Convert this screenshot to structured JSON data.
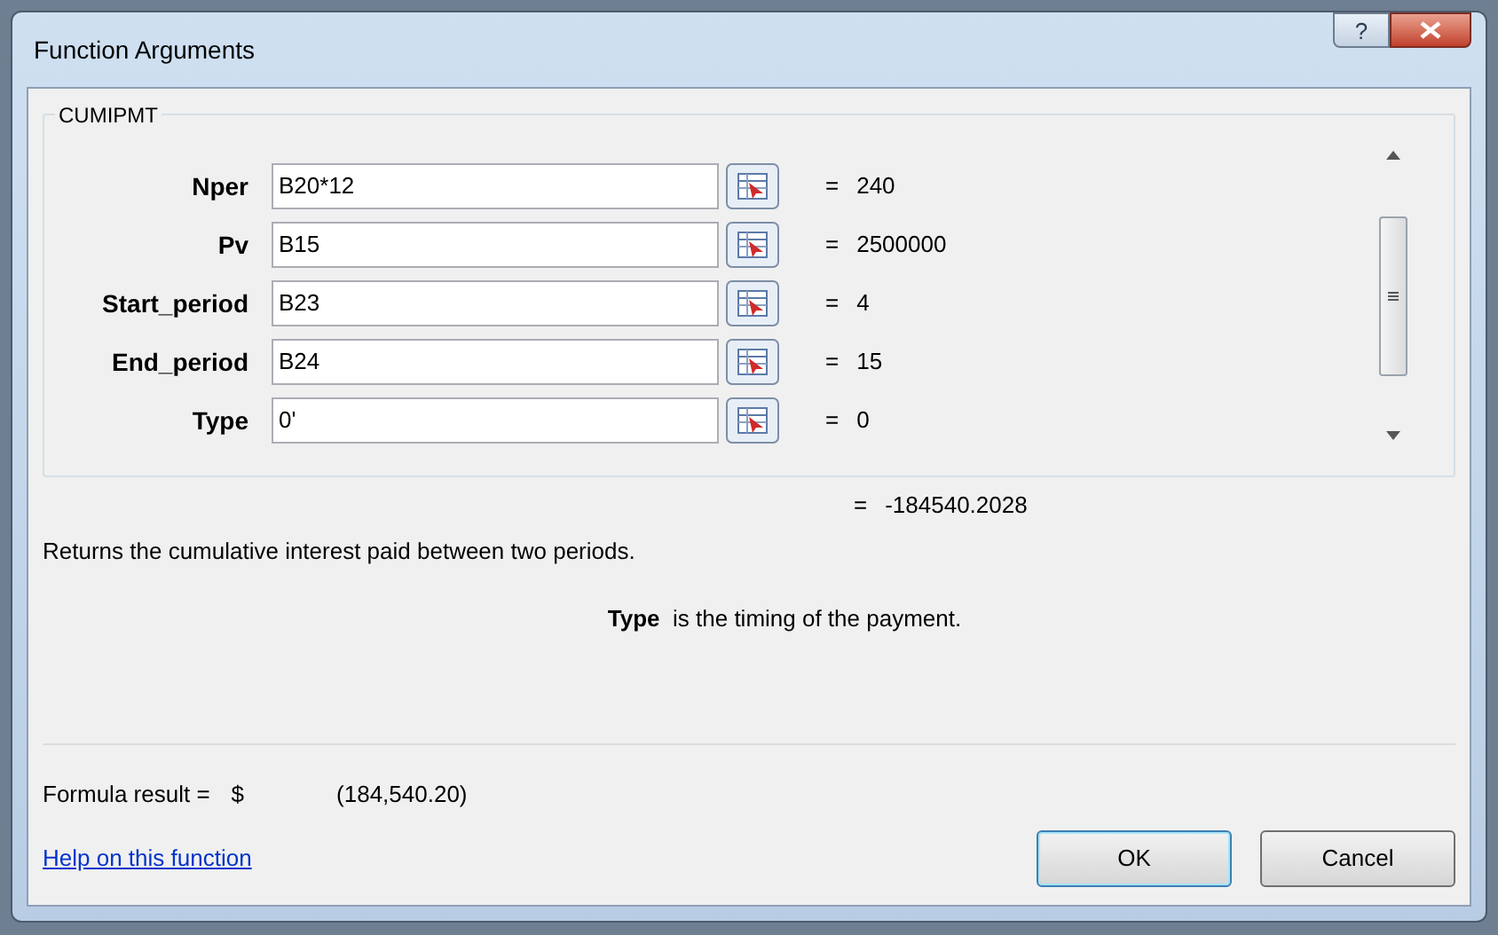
{
  "window": {
    "title": "Function Arguments",
    "help_button": "?"
  },
  "function_name": "CUMIPMT",
  "arguments": [
    {
      "label": "Nper",
      "value": "B20*12",
      "result": "240"
    },
    {
      "label": "Pv",
      "value": "B15",
      "result": "2500000"
    },
    {
      "label": "Start_period",
      "value": "B23",
      "result": "4"
    },
    {
      "label": "End_period",
      "value": "B24",
      "result": "15"
    },
    {
      "label": "Type",
      "value": "0'",
      "result": "0"
    }
  ],
  "equals": "=",
  "overall_result": "-184540.2028",
  "description": "Returns the cumulative interest paid between two periods.",
  "argument_help": "**Type**  is the timing of the payment.",
  "formula_result": {
    "label": "Formula result =",
    "currency": "$",
    "value": "(184,540.20)"
  },
  "help_link": "Help on this function",
  "buttons": [
    {
      "label": "OK",
      "kind": "default"
    },
    {
      "label": "Cancel",
      "kind": "normal"
    }
  ]
}
